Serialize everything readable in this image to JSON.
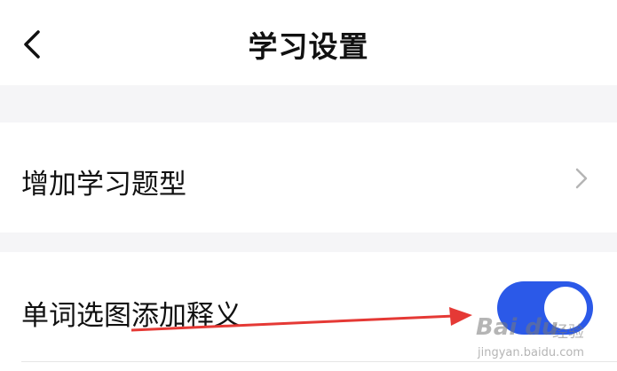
{
  "header": {
    "title": "学习设置",
    "back_icon": "chevron-left-icon"
  },
  "settings": {
    "add_question_type": {
      "label": "增加学习题型",
      "icon": "chevron-right-icon"
    },
    "word_image_definition": {
      "label": "单词选图添加释义",
      "toggle_on": true
    }
  },
  "watermark": {
    "brand": "Bai du",
    "cn": "经验",
    "url": "jingyan.baidu.com"
  },
  "colors": {
    "accent": "#2b59e8",
    "background_gap": "#f5f5f7",
    "text": "#111111",
    "chevron": "#b5b5b5",
    "annotation_arrow": "#e53935"
  }
}
